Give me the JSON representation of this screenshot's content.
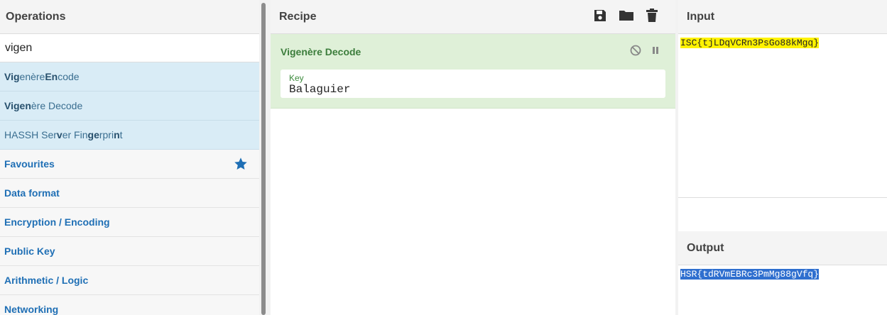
{
  "operations": {
    "title": "Operations",
    "search_value": "vigen",
    "results": [
      {
        "segments": [
          {
            "t": "Vig",
            "b": true
          },
          {
            "t": "enère ",
            "b": false
          },
          {
            "t": "En",
            "b": true
          },
          {
            "t": "code",
            "b": false
          }
        ]
      },
      {
        "segments": [
          {
            "t": "Vigen",
            "b": true
          },
          {
            "t": "ère Decode",
            "b": false
          }
        ]
      },
      {
        "segments": [
          {
            "t": "HASSH Ser",
            "b": false
          },
          {
            "t": "v",
            "b": true
          },
          {
            "t": "er Fin",
            "b": false
          },
          {
            "t": "ge",
            "b": true
          },
          {
            "t": "rpri",
            "b": false
          },
          {
            "t": "n",
            "b": true
          },
          {
            "t": "t",
            "b": false
          }
        ]
      }
    ],
    "categories": [
      "Favourites",
      "Data format",
      "Encryption / Encoding",
      "Public Key",
      "Arithmetic / Logic",
      "Networking"
    ],
    "favourite_star_color": "#1f6fb5"
  },
  "recipe": {
    "title": "Recipe",
    "icons": [
      "save-icon",
      "folder-icon",
      "trash-icon"
    ],
    "operation": {
      "name": "Vigenère Decode",
      "arg_label": "Key",
      "arg_value": "Balaguier",
      "icons": [
        "disable-icon",
        "pause-icon"
      ]
    }
  },
  "input": {
    "title": "Input",
    "text": "ISC{tjLDqVCRn3PsGo88kMgq}",
    "highlight_color": "#fff200"
  },
  "output": {
    "title": "Output",
    "text": "HSR{tdRVmEBRc3PmMg88gVfq}",
    "highlight_color": "#2f6fcf"
  }
}
